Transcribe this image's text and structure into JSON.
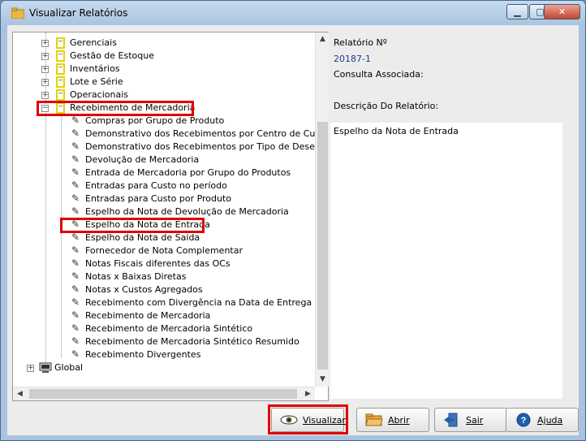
{
  "window": {
    "title": "Visualizar Relatórios"
  },
  "tree": {
    "folders": [
      {
        "label": "Gerenciais",
        "expanded": false
      },
      {
        "label": "Gestão de Estoque",
        "expanded": false
      },
      {
        "label": "Inventários",
        "expanded": false
      },
      {
        "label": "Lote e Série",
        "expanded": false
      },
      {
        "label": "Operacionais",
        "expanded": false
      },
      {
        "label": "Recebimento de Mercadoria",
        "expanded": true
      }
    ],
    "reports": [
      "Compras por Grupo de Produto",
      "Demonstrativo dos Recebimentos por Centro de Custo",
      "Demonstrativo dos Recebimentos por Tipo de Desembolso",
      "Devolução de Mercadoria",
      "Entrada de Mercadoria por Grupo do Produtos",
      "Entradas para Custo no período",
      "Entradas para Custo por Produto",
      "Espelho da Nota de Devolução de Mercadoria",
      "Espelho da Nota de Entrada",
      "Espelho da Nota de Saida",
      "Fornecedor de Nota Complementar",
      "Notas Fiscais diferentes das OCs",
      "Notas x Baixas Diretas",
      "Notas x Custos Agregados",
      "Recebimento com Divergência na Data de Entrega",
      "Recebimento de Mercadoria",
      "Recebimento de Mercadoria Sintético",
      "Recebimento de Mercadoria Sintético Resumido",
      "Recebimento Divergentes"
    ],
    "root": {
      "label": "Global"
    }
  },
  "detail": {
    "relatorio_label": "Relatório Nº",
    "relatorio_value": "20187-1",
    "consulta_label": "Consulta Associada:",
    "descricao_label": "Descrição Do Relatório:",
    "descricao_text": "Espelho da Nota de Entrada"
  },
  "buttons": {
    "visualizar": "Visualizar",
    "abrir": "Abrir",
    "sair": "Sair",
    "ajuda": "Ajuda"
  }
}
